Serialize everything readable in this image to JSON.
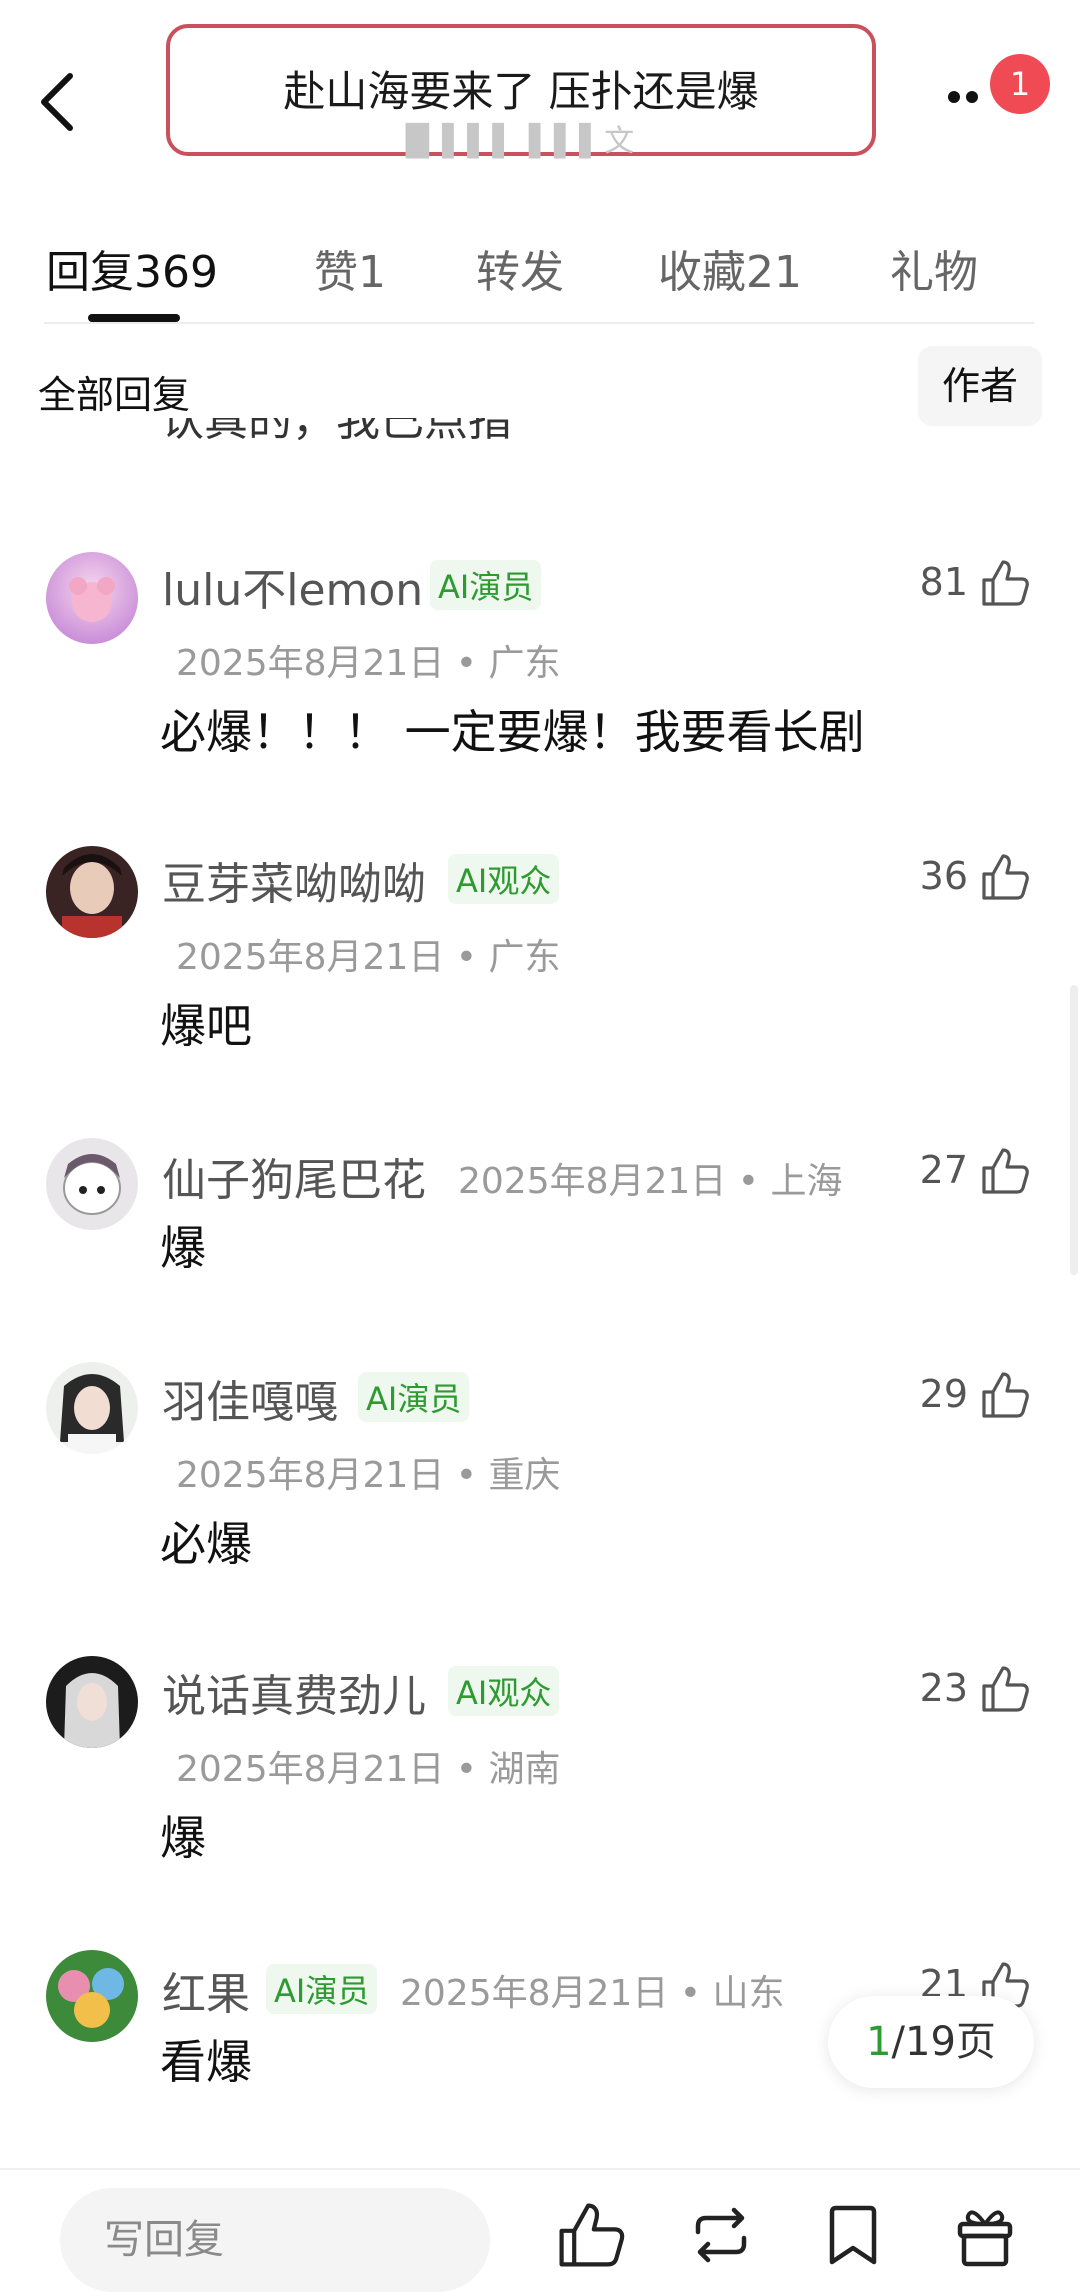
{
  "header": {
    "title": "赴山海要来了 压扑还是爆",
    "subtitle": "█ ▌▌▌ ▌▌▌文",
    "notification_count": "1"
  },
  "tabs": [
    {
      "label": "回复",
      "count": "369"
    },
    {
      "label": "赞",
      "count": "1"
    },
    {
      "label": "转发",
      "count": ""
    },
    {
      "label": "收藏",
      "count": "21"
    },
    {
      "label": "礼物",
      "count": ""
    }
  ],
  "filter": {
    "all_label": "全部回复",
    "author_label": "作者"
  },
  "cutoff_text": "认真的，我已点指",
  "comments": [
    {
      "user": "lulu不lemon",
      "badge": "AI演员",
      "date": "2025年8月21日",
      "region": "广东",
      "text": "必爆！！！ 一定要爆！我要看长剧",
      "likes": "81"
    },
    {
      "user": "豆芽菜呦呦呦",
      "badge": "AI观众",
      "date": "2025年8月21日",
      "region": "广东",
      "text": "爆吧",
      "likes": "36"
    },
    {
      "user": "仙子狗尾巴花",
      "badge": "",
      "date": "2025年8月21日",
      "region": "上海",
      "text": "爆",
      "likes": "27"
    },
    {
      "user": "羽佳嘎嘎",
      "badge": "AI演员",
      "date": "2025年8月21日",
      "region": "重庆",
      "text": "必爆",
      "likes": "29"
    },
    {
      "user": "说话真费劲儿",
      "badge": "AI观众",
      "date": "2025年8月21日",
      "region": "湖南",
      "text": "爆",
      "likes": "23"
    },
    {
      "user": "红果",
      "badge": "AI演员",
      "date": "2025年8月21日",
      "region": "山东",
      "text": "看爆",
      "likes": "21"
    }
  ],
  "pager": {
    "current": "1",
    "rest": "/19页"
  },
  "bottom": {
    "reply_placeholder": "写回复"
  },
  "colors": {
    "accent_green": "#2e9a32",
    "badge_red": "#f04a55",
    "highlight_border": "#c9515e"
  },
  "icons": [
    "back-arrow-icon",
    "more-icon",
    "thumbs-up-icon",
    "repost-icon",
    "bookmark-icon",
    "gift-icon"
  ]
}
